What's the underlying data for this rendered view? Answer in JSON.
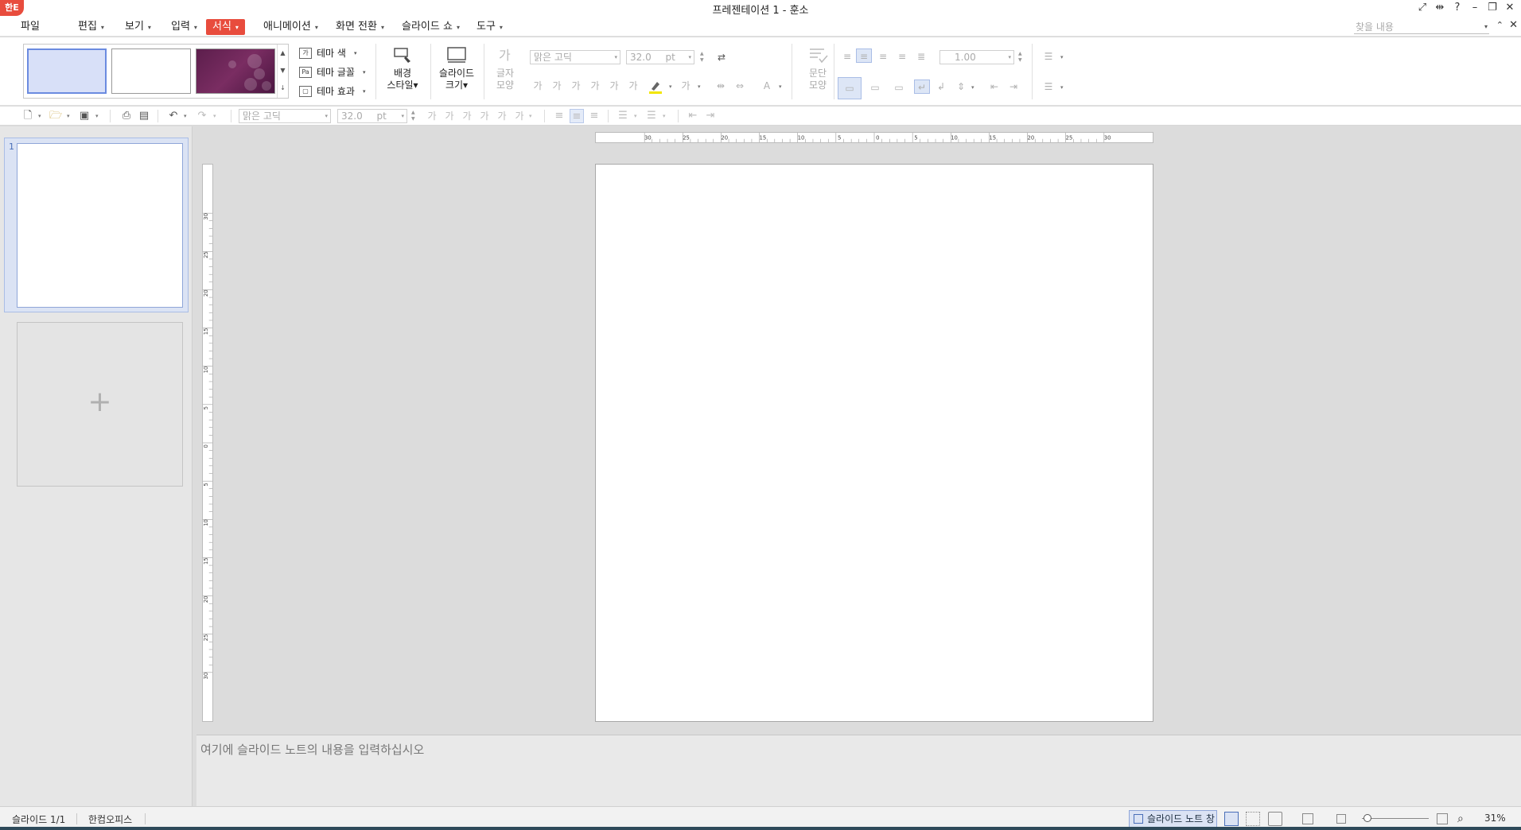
{
  "window": {
    "app_logo": "한E",
    "title": "프레젠테이션 1 - 훈소",
    "controls": [
      "⤢",
      "⇹",
      "?",
      "–",
      "❐",
      "✕"
    ]
  },
  "menu": {
    "items": [
      {
        "label": "파일",
        "arrow": ""
      },
      {
        "label": "편집",
        "arrow": "▾"
      },
      {
        "label": "보기",
        "arrow": "▾"
      },
      {
        "label": "입력",
        "arrow": "▾"
      },
      {
        "label": "서식",
        "arrow": "▾"
      },
      {
        "label": "애니메이션",
        "arrow": "▾"
      },
      {
        "label": "화면 전환",
        "arrow": "▾"
      },
      {
        "label": "슬라이드 쇼",
        "arrow": "▾"
      },
      {
        "label": "도구",
        "arrow": "▾"
      }
    ],
    "active": "서식",
    "search_placeholder": "찾을 내용",
    "collapse": "⌃",
    "close": "✕"
  },
  "ribbon": {
    "theme_options": [
      {
        "label": "테마 색",
        "icon": "가"
      },
      {
        "label": "테마 글꼴",
        "icon": "Pa"
      },
      {
        "label": "테마 효과",
        "icon": "▢"
      }
    ],
    "background_style": {
      "line1": "배경",
      "line2": "스타일▾"
    },
    "slide_size": {
      "line1": "슬라이드",
      "line2": "크기▾"
    },
    "char_shape": {
      "line1": "글자",
      "line2": "모양"
    },
    "para_shape": {
      "line1": "문단",
      "line2": "모양"
    },
    "font_name": "맑은 고딕",
    "font_size": "32.0",
    "font_unit": "pt",
    "line_spacing": "1.00"
  },
  "toolbar2": {
    "font_name": "맑은 고딕",
    "font_size": "32.0",
    "font_unit": "pt"
  },
  "slides": {
    "current_number": "1",
    "add_symbol": "+"
  },
  "ruler": {
    "h_labels": [
      "30",
      "25",
      "20",
      "15",
      "10",
      "5",
      "0",
      "5",
      "10",
      "15",
      "20",
      "25",
      "30"
    ],
    "v_labels": [
      "30",
      "25",
      "20",
      "15",
      "10",
      "5",
      "0",
      "5",
      "10",
      "15",
      "20",
      "25",
      "30"
    ]
  },
  "notes": {
    "placeholder": "여기에 슬라이드 노트의 내용을 입력하십시오"
  },
  "status": {
    "slide_info": "슬라이드 1/1",
    "app_name": "한컴오피스",
    "notes_toggle": "슬라이드 노트 창",
    "zoom": "31%"
  }
}
